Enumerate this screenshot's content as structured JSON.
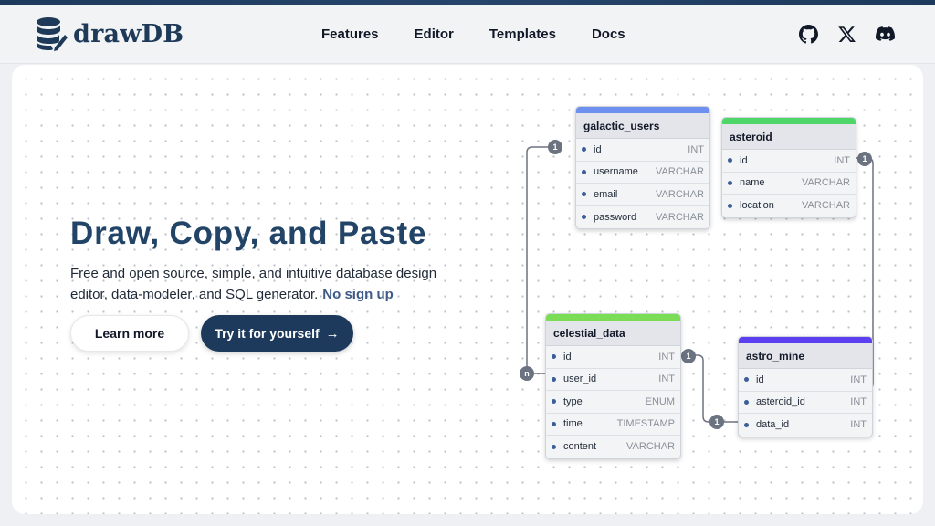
{
  "brand": {
    "name": "drawDB"
  },
  "nav": {
    "links": [
      "Features",
      "Editor",
      "Templates",
      "Docs"
    ]
  },
  "socials": [
    "github-icon",
    "x-icon",
    "discord-icon"
  ],
  "hero": {
    "title": "Draw, Copy, and Paste",
    "desc_line1": "Free and open source, simple, and intuitive database design",
    "desc_line2": "editor, data-modeler, and SQL generator.",
    "nosignup": "No sign up",
    "learn_more": "Learn more",
    "try_it": "Try it for yourself"
  },
  "colors": {
    "brand": "#1d3a5c",
    "galactic_users": "#6d8ff0",
    "asteroid": "#4fd669",
    "celestial_data": "#7bdc55",
    "astro_mine": "#5c3ff0"
  },
  "tables": {
    "galactic_users": {
      "name": "galactic_users",
      "fields": [
        {
          "name": "id",
          "type": "INT"
        },
        {
          "name": "username",
          "type": "VARCHAR"
        },
        {
          "name": "email",
          "type": "VARCHAR"
        },
        {
          "name": "password",
          "type": "VARCHAR"
        }
      ]
    },
    "asteroid": {
      "name": "asteroid",
      "fields": [
        {
          "name": "id",
          "type": "INT"
        },
        {
          "name": "name",
          "type": "VARCHAR"
        },
        {
          "name": "location",
          "type": "VARCHAR"
        }
      ]
    },
    "celestial_data": {
      "name": "celestial_data",
      "fields": [
        {
          "name": "id",
          "type": "INT"
        },
        {
          "name": "user_id",
          "type": "INT"
        },
        {
          "name": "type",
          "type": "ENUM"
        },
        {
          "name": "time",
          "type": "TIMESTAMP"
        },
        {
          "name": "content",
          "type": "VARCHAR"
        }
      ]
    },
    "astro_mine": {
      "name": "astro_mine",
      "fields": [
        {
          "name": "id",
          "type": "INT"
        },
        {
          "name": "asteroid_id",
          "type": "INT"
        },
        {
          "name": "data_id",
          "type": "INT"
        }
      ]
    }
  },
  "relations": {
    "one": "1",
    "many": "n"
  }
}
